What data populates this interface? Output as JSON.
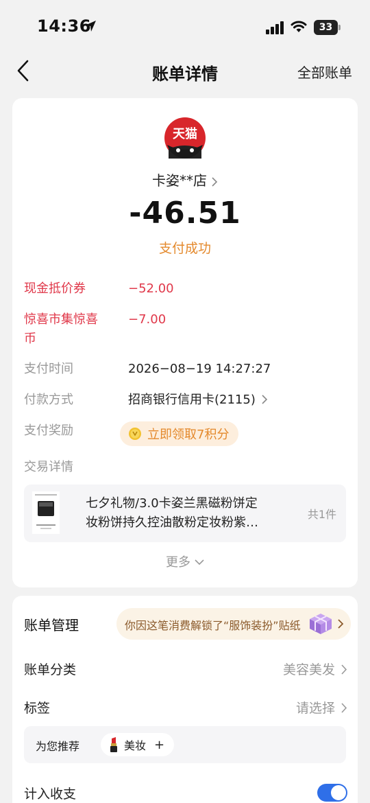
{
  "status_bar": {
    "time": "14:36",
    "battery": "33",
    "battery_level": 0.33
  },
  "nav": {
    "title": "账单详情",
    "right_link": "全部账单"
  },
  "merchant": {
    "logo_text": "天猫",
    "name": "卡姿**店",
    "amount": "-46.51",
    "status": "支付成功"
  },
  "details": {
    "coupon_label": "现金抵价券",
    "coupon_value": "−52.00",
    "surprise_label": "惊喜市集惊喜币",
    "surprise_value": "−7.00",
    "time_label": "支付时间",
    "time_value": "2026−08−19 14:27:27",
    "method_label": "付款方式",
    "method_value": "招商银行信用卡(2115)",
    "reward_label": "支付奖励",
    "reward_value": "立即领取7积分",
    "trade_label": "交易详情"
  },
  "item": {
    "title_line1": "七夕礼物/3.0卡姿兰黑磁粉饼定",
    "title_line2": "妆粉饼持久控油散粉定妆粉紫…",
    "count": "共1件"
  },
  "more_label": "更多",
  "management": {
    "title": "账单管理",
    "unlock_text": "你因这笔消费解锁了“服饰装扮”贴纸",
    "category_label": "账单分类",
    "category_value": "美容美发",
    "tag_label": "标签",
    "tag_value": "请选择",
    "recommend_label": "为您推荐",
    "recommend_chip": "美妆",
    "recommend_add": "+",
    "income_label": "计入收支",
    "income_enabled": true
  },
  "colors": {
    "accent_orange": "#e4892c",
    "discount_red": "#e0384a",
    "toggle_blue": "#2f6fe8",
    "tmall_red": "#d8262b"
  }
}
